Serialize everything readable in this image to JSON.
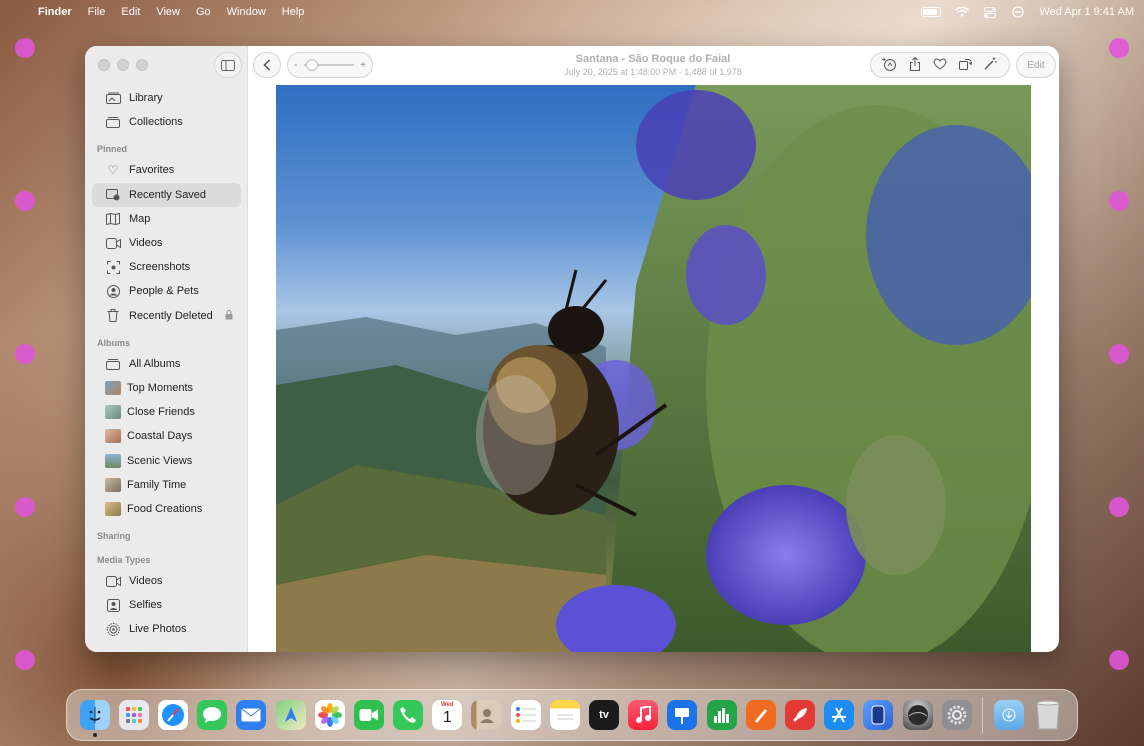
{
  "menubar": {
    "app_name": "Finder",
    "menus": [
      "File",
      "Edit",
      "View",
      "Go",
      "Window",
      "Help"
    ],
    "clock": "Wed Apr 1  9:41 AM",
    "apple_icon": "apple-logo-icon"
  },
  "window": {
    "title": "Santana - São Roque do Faial",
    "subtitle": "July 20, 2025 at 1:48:00 PM  ·  1,488 of 1,978",
    "edit_label": "Edit",
    "zoom_minus": "-",
    "zoom_plus": "+",
    "zoom_level": 0.15
  },
  "sidebar": {
    "library": [
      {
        "label": "Library",
        "icon": "library-icon"
      },
      {
        "label": "Collections",
        "icon": "collections-icon"
      }
    ],
    "pinned_header": "Pinned",
    "pinned": [
      {
        "label": "Favorites",
        "icon": "heart-icon"
      },
      {
        "label": "Recently Saved",
        "icon": "recently-saved-icon"
      },
      {
        "label": "Map",
        "icon": "map-icon"
      },
      {
        "label": "Videos",
        "icon": "video-icon"
      },
      {
        "label": "Screenshots",
        "icon": "screenshot-icon"
      },
      {
        "label": "People & Pets",
        "icon": "person-icon"
      },
      {
        "label": "Recently Deleted",
        "icon": "trash-icon"
      }
    ],
    "albums_header": "Albums",
    "albums": [
      {
        "label": "All Albums",
        "icon": "albums-icon"
      },
      {
        "label": "Top Moments",
        "color": "#a87b54"
      },
      {
        "label": "Close Friends",
        "color": "#8fa3a0"
      },
      {
        "label": "Coastal Days",
        "color": "#c49a82"
      },
      {
        "label": "Scenic Views",
        "color": "#7f9bb1"
      },
      {
        "label": "Family Time",
        "color": "#9c8f80"
      },
      {
        "label": "Food Creations",
        "color": "#b79a6a"
      }
    ],
    "sharing_header": "Sharing",
    "media_header": "Media Types",
    "media": [
      {
        "label": "Videos",
        "icon": "video-icon"
      },
      {
        "label": "Selfies",
        "icon": "selfie-icon"
      },
      {
        "label": "Live Photos",
        "icon": "live-photo-icon"
      }
    ]
  },
  "dock": {
    "apps": [
      {
        "name": "finder",
        "color": "#2a8cf0"
      },
      {
        "name": "launchpad",
        "color": "#e8e8ee"
      },
      {
        "name": "safari",
        "color": "#1e90ff"
      },
      {
        "name": "messages",
        "color": "#34c759"
      },
      {
        "name": "mail",
        "color": "#2f7ff0"
      },
      {
        "name": "maps",
        "color": "#5ab55a"
      },
      {
        "name": "photos",
        "color": "#ffffff"
      },
      {
        "name": "facetime",
        "color": "#30c050"
      },
      {
        "name": "phone",
        "color": "#34c759"
      },
      {
        "name": "calendar",
        "color": "#ffffff"
      },
      {
        "name": "contacts",
        "color": "#c9b9a2"
      },
      {
        "name": "reminders",
        "color": "#ffffff"
      },
      {
        "name": "notes",
        "color": "#ffd54a"
      },
      {
        "name": "tv",
        "color": "#1b1b1b"
      },
      {
        "name": "music",
        "color": "#fa3c55"
      },
      {
        "name": "keynote",
        "color": "#1a73e8"
      },
      {
        "name": "numbers",
        "color": "#22a447"
      },
      {
        "name": "pages",
        "color": "#f06a20"
      },
      {
        "name": "rocket",
        "color": "#e53935"
      },
      {
        "name": "app-store",
        "color": "#1c8bf2"
      },
      {
        "name": "iphone-mirroring",
        "color": "#2f63d8"
      },
      {
        "name": "macos-icon",
        "color": "#3c3c3c"
      },
      {
        "name": "system-settings",
        "color": "#8e8e93"
      }
    ],
    "calendar_month": "Wed",
    "calendar_day": "1",
    "tv_label": "tv"
  }
}
